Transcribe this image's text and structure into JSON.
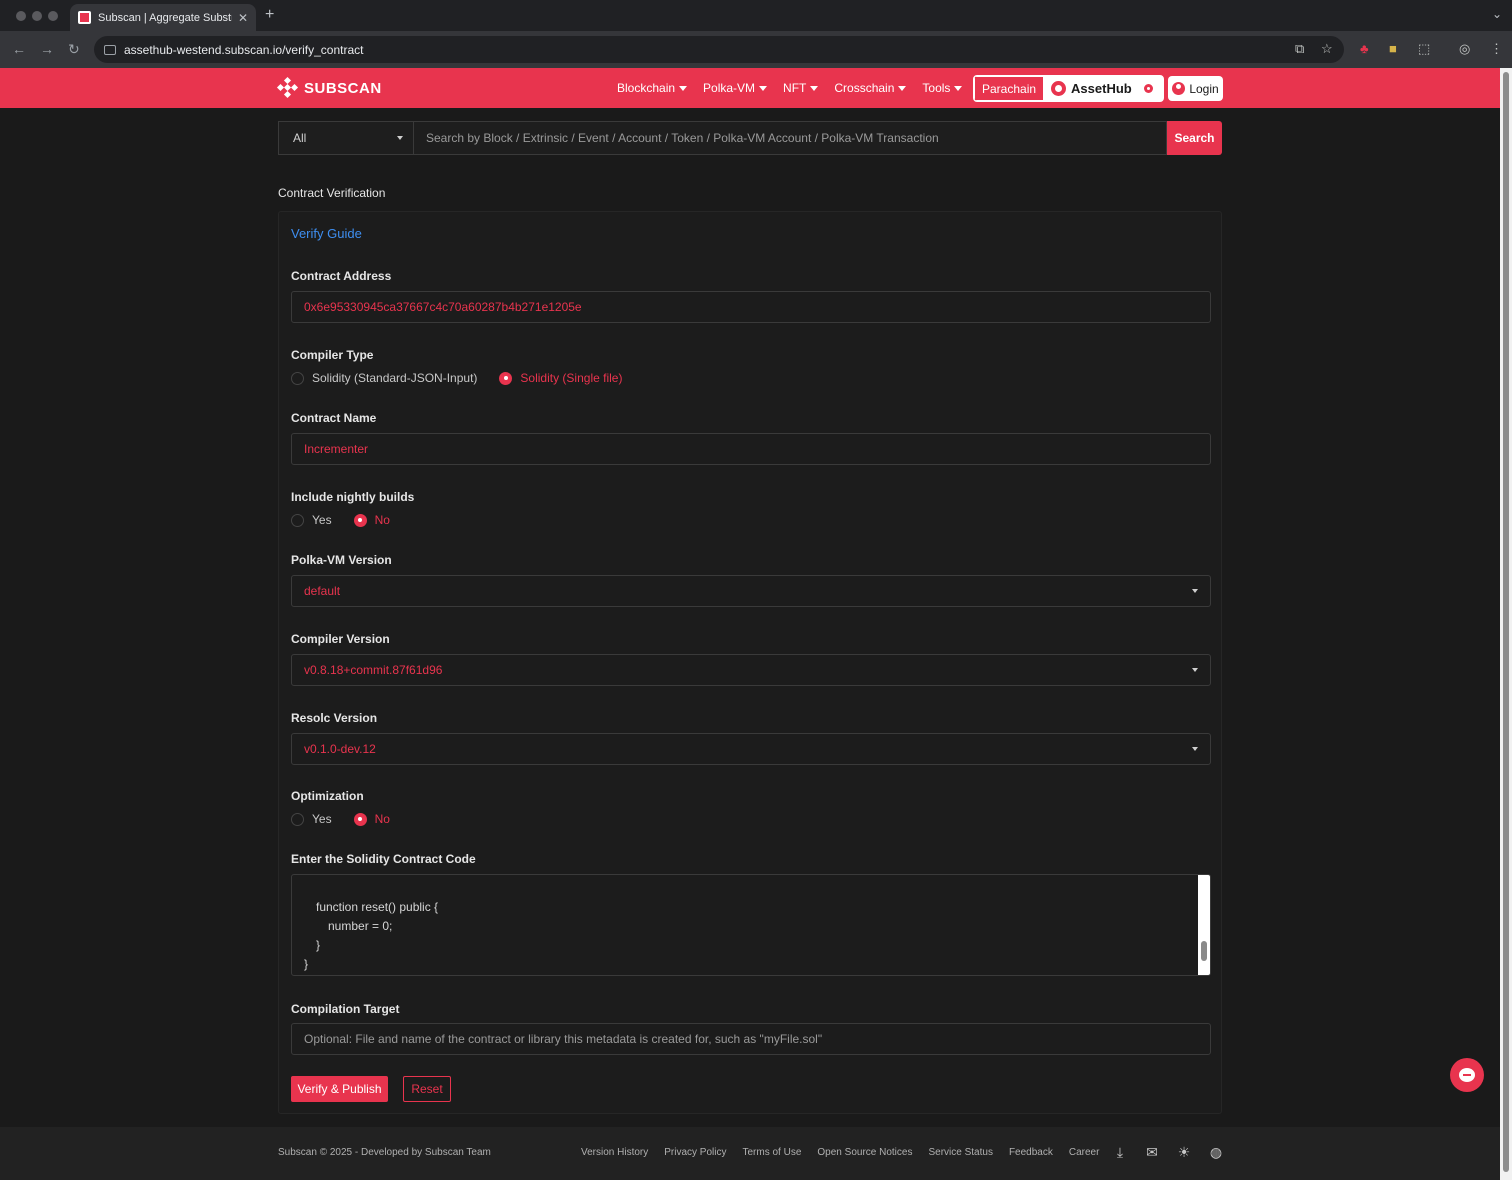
{
  "browser": {
    "tab_title": "Subscan | Aggregate Substra",
    "url": "assethub-westend.subscan.io/verify_contract"
  },
  "header": {
    "logo_text": "SUBSCAN",
    "menu": [
      "Blockchain",
      "Polka-VM",
      "NFT",
      "Crosschain",
      "Tools"
    ],
    "parachain_label": "Parachain",
    "network_name": "AssetHub",
    "login_label": "Login",
    "brand_color": "#e8344e"
  },
  "search": {
    "filter_value": "All",
    "placeholder": "Search by Block / Extrinsic / Event / Account / Token / Polka-VM Account / Polka-VM Transaction",
    "button_label": "Search"
  },
  "page": {
    "section_title": "Contract Verification",
    "verify_guide": "Verify Guide"
  },
  "form": {
    "contract_address": {
      "label": "Contract Address",
      "value": "0x6e95330945ca37667c4c70a60287b4b271e1205e"
    },
    "compiler_type": {
      "label": "Compiler Type",
      "options": [
        "Solidity (Standard-JSON-Input)",
        "Solidity (Single file)"
      ],
      "selected": "Solidity (Single file)"
    },
    "contract_name": {
      "label": "Contract Name",
      "value": "Incrementer"
    },
    "nightly": {
      "label": "Include nightly builds",
      "options": [
        "Yes",
        "No"
      ],
      "selected": "No"
    },
    "polkavm_version": {
      "label": "Polka-VM Version",
      "value": "default"
    },
    "compiler_version": {
      "label": "Compiler Version",
      "value": "v0.8.18+commit.87f61d96"
    },
    "resolc_version": {
      "label": "Resolc Version",
      "value": "v0.1.0-dev.12"
    },
    "optimization": {
      "label": "Optimization",
      "options": [
        "Yes",
        "No"
      ],
      "selected": "No"
    },
    "code": {
      "label": "Enter the Solidity Contract Code",
      "visible_lines": [
        "function reset() public {",
        "number = 0;",
        "}",
        "}"
      ]
    },
    "compilation_target": {
      "label": "Compilation Target",
      "placeholder": "Optional: File and name of the contract or library this metadata is created for, such as \"myFile.sol\""
    },
    "verify_button": "Verify & Publish",
    "reset_button": "Reset"
  },
  "footer": {
    "copyright": "Subscan © 2025 - Developed by Subscan Team",
    "links": [
      "Version History",
      "Privacy Policy",
      "Terms of Use",
      "Open Source Notices",
      "Service Status",
      "Feedback",
      "Career"
    ],
    "icons": [
      "download-icon",
      "mail-icon",
      "theme-icon",
      "language-icon"
    ]
  }
}
